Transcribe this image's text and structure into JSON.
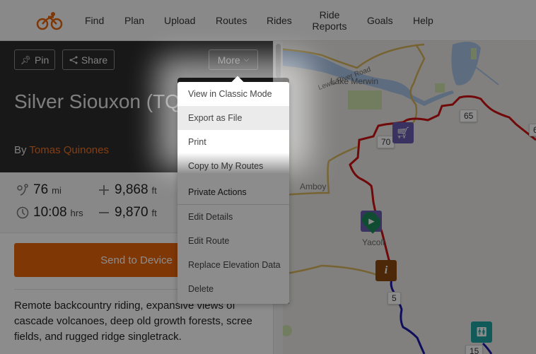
{
  "header": {
    "logo": "cyclist-logo",
    "nav": [
      {
        "label": "Find"
      },
      {
        "label": "Plan"
      },
      {
        "label": "Upload"
      },
      {
        "label": "Routes"
      },
      {
        "label": "Rides"
      },
      {
        "label": "Ride Reports"
      },
      {
        "label": "Goals"
      },
      {
        "label": "Help"
      }
    ]
  },
  "route": {
    "pin_label": "Pin",
    "share_label": "Share",
    "more_label": "More",
    "title": "Silver Siouxon (TQ",
    "by_prefix": "By",
    "author": "Tomas Quinones",
    "stats": {
      "distance": {
        "value": "76",
        "unit": "mi"
      },
      "time": {
        "value": "10:08",
        "unit": "hrs"
      },
      "elevation_gain": {
        "value": "9,868",
        "unit": "ft"
      },
      "elevation_loss": {
        "value": "9,870",
        "unit": "ft"
      }
    },
    "send_label": "Send to Device",
    "description": "Remote backcountry riding, expansive views of cascade volcanoes, deep old growth forests, scree fields, and rugged ridge singletrack."
  },
  "more_menu": {
    "items": [
      {
        "label": "View in Classic Mode"
      },
      {
        "label": "Export as File",
        "highlighted": true
      },
      {
        "label": "Print"
      },
      {
        "label": "Copy to My Routes"
      }
    ],
    "private_header": "Private Actions",
    "private_items": [
      {
        "label": "Edit Details"
      },
      {
        "label": "Edit Route"
      },
      {
        "label": "Replace Elevation Data"
      },
      {
        "label": "Delete"
      }
    ]
  },
  "map": {
    "labels": {
      "road": "Lewis River Road",
      "lake": "Lake Merwin",
      "town1": "Amboy",
      "town2": "Yacolt"
    },
    "mile_markers": [
      "70",
      "65",
      "6",
      "5",
      "15"
    ],
    "pois": [
      "grocery-icon",
      "start-icon",
      "info-icon",
      "restroom-icon"
    ],
    "colors": {
      "route_red": "#cc1111",
      "route_blue": "#1a1aa8",
      "road": "#d7b45a",
      "water": "#a9c5e8",
      "park": "#cfe4b0"
    }
  },
  "colors": {
    "brand": "#e8650c",
    "hero_bg": "#2c2c2c"
  }
}
